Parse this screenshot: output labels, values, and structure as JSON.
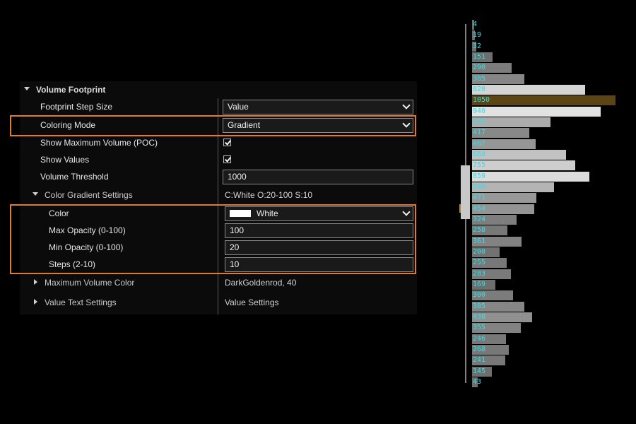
{
  "panel": {
    "section_title": "Volume Footprint",
    "rows": {
      "step_size": {
        "label": "Footprint Step Size",
        "value": "Value"
      },
      "coloring_mode": {
        "label": "Coloring Mode",
        "value": "Gradient"
      },
      "show_poc": {
        "label": "Show Maximum Volume (POC)",
        "checked": true
      },
      "show_values": {
        "label": "Show Values",
        "checked": true
      },
      "threshold": {
        "label": "Volume Threshold",
        "value": "1000"
      },
      "gradient": {
        "label": "Color Gradient Settings",
        "summary": "C:White O:20-100 S:10"
      },
      "color": {
        "label": "Color",
        "value": "White",
        "swatch": "#ffffff"
      },
      "max_opacity": {
        "label": "Max Opacity (0-100)",
        "value": "100"
      },
      "min_opacity": {
        "label": "Min Opacity (0-100)",
        "value": "20"
      },
      "steps": {
        "label": "Steps (2-10)",
        "value": "10"
      },
      "max_volume_color": {
        "label": "Maximum Volume Color",
        "summary": "DarkGoldenrod, 40"
      },
      "value_text": {
        "label": "Value Text Settings",
        "summary": "Value Settings"
      }
    },
    "highlight_color": "#e07b2e"
  },
  "profile": {
    "label_color": "#33e0e6",
    "poc_color": "#5c4414",
    "max_value": 1050,
    "levels": [
      {
        "value": "4",
        "shade": 0.35
      },
      {
        "value": "19",
        "shade": 0.35
      },
      {
        "value": "32",
        "shade": 0.35
      },
      {
        "value": "151",
        "shade": 0.35
      },
      {
        "value": "290",
        "shade": 0.42
      },
      {
        "value": "385",
        "shade": 0.47
      },
      {
        "value": "828",
        "shade": 0.86
      },
      {
        "value": "1050",
        "shade": "poc"
      },
      {
        "value": "940",
        "shade": 0.93
      },
      {
        "value": "576",
        "shade": 0.66
      },
      {
        "value": "417",
        "shade": 0.48
      },
      {
        "value": "467",
        "shade": 0.55
      },
      {
        "value": "688",
        "shade": 0.77
      },
      {
        "value": "755",
        "shade": 0.83
      },
      {
        "value": "859",
        "shade": 0.9
      },
      {
        "value": "599",
        "shade": 0.7
      },
      {
        "value": "471",
        "shade": 0.56
      },
      {
        "value": "454",
        "shade": 0.54
      },
      {
        "value": "324",
        "shade": 0.43
      },
      {
        "value": "258",
        "shade": 0.4
      },
      {
        "value": "361",
        "shade": 0.45
      },
      {
        "value": "200",
        "shade": 0.37
      },
      {
        "value": "255",
        "shade": 0.4
      },
      {
        "value": "283",
        "shade": 0.41
      },
      {
        "value": "169",
        "shade": 0.35
      },
      {
        "value": "300",
        "shade": 0.42
      },
      {
        "value": "385",
        "shade": 0.47
      },
      {
        "value": "438",
        "shade": 0.52
      },
      {
        "value": "355",
        "shade": 0.45
      },
      {
        "value": "246",
        "shade": 0.4
      },
      {
        "value": "268",
        "shade": 0.4
      },
      {
        "value": "241",
        "shade": 0.4
      },
      {
        "value": "145",
        "shade": 0.35
      },
      {
        "value": "43",
        "shade": 0.35
      }
    ]
  }
}
